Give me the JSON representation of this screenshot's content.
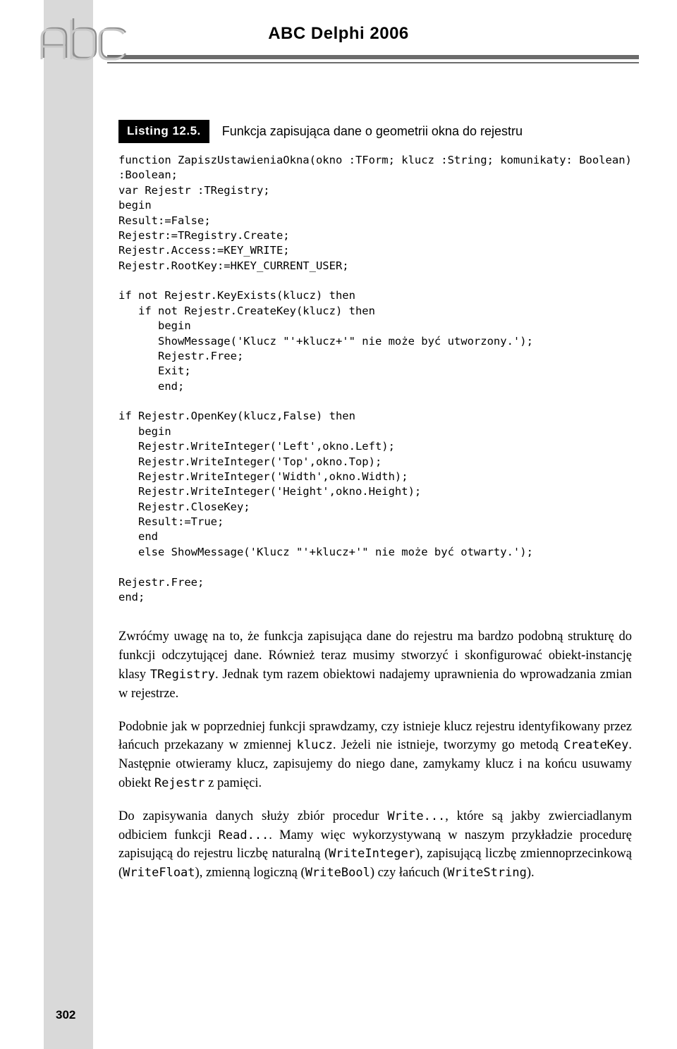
{
  "header": {
    "title": "ABC Delphi 2006"
  },
  "listing": {
    "badge": "Listing 12.5.",
    "caption": "Funkcja zapisująca dane o geometrii okna do rejestru"
  },
  "code": "function ZapiszUstawieniaOkna(okno :TForm; klucz :String; komunikaty: Boolean)\n:Boolean;\nvar Rejestr :TRegistry;\nbegin\nResult:=False;\nRejestr:=TRegistry.Create;\nRejestr.Access:=KEY_WRITE;\nRejestr.RootKey:=HKEY_CURRENT_USER;\n\nif not Rejestr.KeyExists(klucz) then\n   if not Rejestr.CreateKey(klucz) then\n      begin\n      ShowMessage('Klucz \"'+klucz+'\" nie może być utworzony.');\n      Rejestr.Free;\n      Exit;\n      end;\n\nif Rejestr.OpenKey(klucz,False) then\n   begin\n   Rejestr.WriteInteger('Left',okno.Left);\n   Rejestr.WriteInteger('Top',okno.Top);\n   Rejestr.WriteInteger('Width',okno.Width);\n   Rejestr.WriteInteger('Height',okno.Height);\n   Rejestr.CloseKey;\n   Result:=True;\n   end\n   else ShowMessage('Klucz \"'+klucz+'\" nie może być otwarty.');\n\nRejestr.Free;\nend;",
  "body": {
    "p1": {
      "t1": "Zwróćmy uwagę na to, że funkcja zapisująca dane do rejestru ma bardzo podobną strukturę do funkcji odczytującej dane. Również teraz musimy stworzyć i skonfigurować obiekt-instancję klasy ",
      "c1": "TRegistry",
      "t2": ". Jednak tym razem obiektowi nadajemy uprawnienia do wprowadzania zmian w rejestrze."
    },
    "p2": {
      "t1": "Podobnie jak w poprzedniej funkcji sprawdzamy, czy istnieje klucz rejestru identyfikowany przez łańcuch przekazany w zmiennej ",
      "c1": "klucz",
      "t2": ". Jeżeli nie istnieje, tworzymy go metodą ",
      "c2": "CreateKey",
      "t3": ". Następnie otwieramy klucz, zapisujemy do niego dane, zamykamy klucz i na końcu usuwamy obiekt ",
      "c3": "Rejestr",
      "t4": " z pamięci."
    },
    "p3": {
      "t1": "Do zapisywania danych służy zbiór procedur ",
      "c1": "Write...",
      "t2": ", które są jakby zwierciadlanym odbiciem funkcji ",
      "c2": "Read...",
      "t3": ". Mamy więc wykorzystywaną w naszym przykładzie procedurę zapisującą do rejestru liczbę naturalną (",
      "c3": "WriteInteger",
      "t4": "), zapisującą liczbę zmiennoprzecinkową (",
      "c4": "WriteFloat",
      "t5": "), zmienną logiczną (",
      "c5": "WriteBool",
      "t6": ") czy łańcuch (",
      "c6": "WriteString",
      "t7": ")."
    }
  },
  "page_number": "302"
}
